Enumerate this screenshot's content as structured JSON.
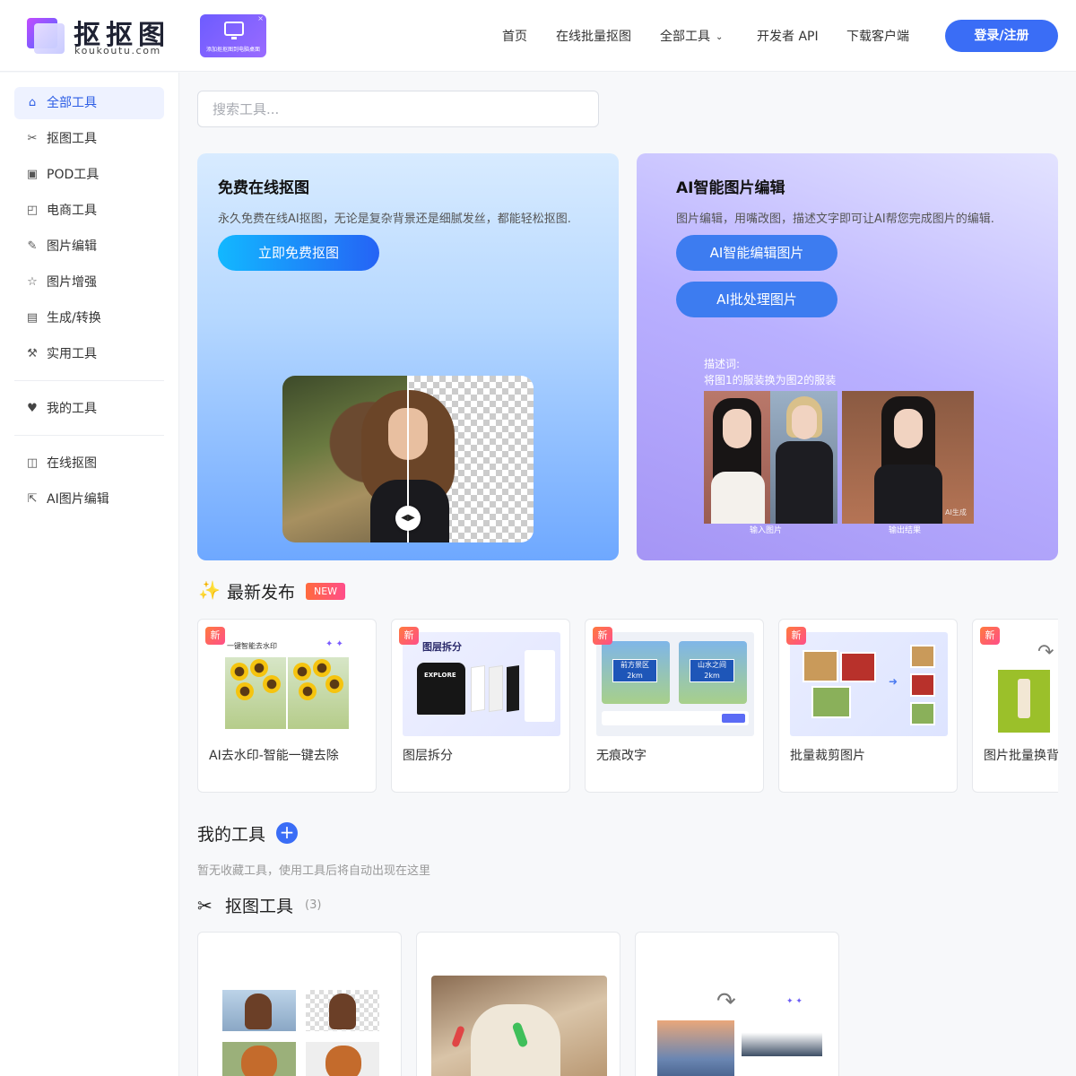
{
  "header": {
    "logo_cn": "抠抠图",
    "logo_en": "koukoutu.com",
    "promo_text": "添加抠抠图到电脑桌面",
    "nav": [
      {
        "label": "首页"
      },
      {
        "label": "在线批量抠图"
      },
      {
        "label": "全部工具"
      },
      {
        "label": "开发者 API"
      },
      {
        "label": "下载客户端"
      }
    ],
    "login_label": "登录/注册"
  },
  "sidebar": {
    "items": [
      {
        "label": "全部工具",
        "icon": "home-icon"
      },
      {
        "label": "抠图工具",
        "icon": "scissors-icon"
      },
      {
        "label": "POD工具",
        "icon": "shirt-icon"
      },
      {
        "label": "电商工具",
        "icon": "shopping-bag-icon"
      },
      {
        "label": "图片编辑",
        "icon": "pencil-icon"
      },
      {
        "label": "图片增强",
        "icon": "star-icon"
      },
      {
        "label": "生成/转换",
        "icon": "robot-icon"
      },
      {
        "label": "实用工具",
        "icon": "wrench-icon"
      }
    ],
    "mine": {
      "label": "我的工具",
      "icon": "heart-icon"
    },
    "links": [
      {
        "label": "在线抠图",
        "icon": "image-cutout-icon"
      },
      {
        "label": "AI图片编辑",
        "icon": "edit-external-icon"
      }
    ]
  },
  "search": {
    "placeholder": "搜索工具..."
  },
  "hero_left": {
    "title": "免费在线抠图",
    "desc": "永久免费在线AI抠图，无论是复杂背景还是细腻发丝，都能轻松抠图.",
    "button": "立即免费抠图"
  },
  "hero_right": {
    "title": "AI智能图片编辑",
    "desc": "图片编辑，用嘴改图，描述文字即可让AI帮您完成图片的编辑.",
    "button1": "AI智能编辑图片",
    "button2": "AI批处理图片",
    "prompt_label": "描述词:",
    "prompt_text": "将图1的服装换为图2的服装",
    "caption_input": "输入图片",
    "caption_output": "输出结果",
    "ai_mark": "AI生成"
  },
  "latest": {
    "title": "最新发布",
    "tag": "NEW",
    "badge": "新",
    "cards": [
      {
        "title": "AI去水印-智能一键去除",
        "thumb_text": "一键智能去水印"
      },
      {
        "title": "图层拆分",
        "thumb_text": "图层拆分",
        "thumb_sub": "EXPLORE"
      },
      {
        "title": "无痕改字",
        "sign_left": "前方景区",
        "sign_right": "山水之间",
        "sign_dist": "2km"
      },
      {
        "title": "批量裁剪图片"
      },
      {
        "title": "图片批量换背景"
      }
    ]
  },
  "my_tools": {
    "title": "我的工具",
    "empty": "暂无收藏工具，使用工具后将自动出现在这里"
  },
  "cutout_tools": {
    "title": "抠图工具",
    "count": "(3)"
  },
  "colors": {
    "accent": "#3a6df6",
    "active_bg": "#eef2ff",
    "new_tag": "#ff5a6a"
  }
}
